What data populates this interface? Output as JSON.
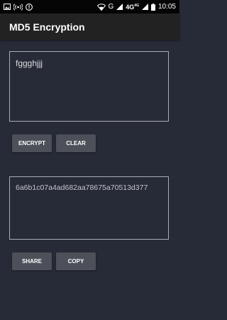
{
  "status_bar": {
    "left_icons": [
      "image-icon",
      "hotspot-icon",
      "alert-icon"
    ],
    "carrier": "G",
    "network": "4G",
    "network_sup": "4G",
    "time": "10:05"
  },
  "app_bar": {
    "title": "MD5 Encryption"
  },
  "input": {
    "value": "fggghjjj"
  },
  "buttons": {
    "encrypt_label": "ENCRYPT",
    "clear_label": "CLEAR",
    "share_label": "SHARE",
    "copy_label": "COPY"
  },
  "output": {
    "value": "6a6b1c07a4ad682aa78675a70513d377"
  },
  "colors": {
    "background": "#272b37",
    "app_bar": "#222222",
    "status_bar": "#050505",
    "button": "#4d5058",
    "field_border": "#a9acb4"
  }
}
